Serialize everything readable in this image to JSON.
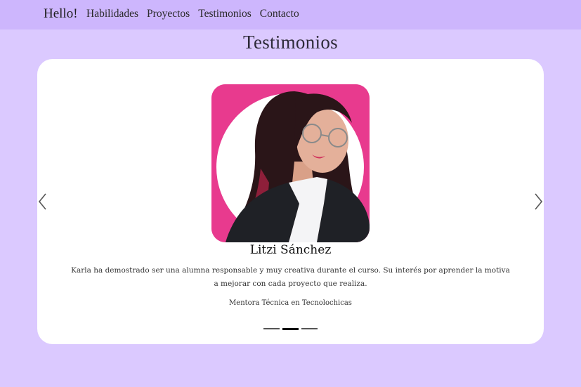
{
  "navbar": {
    "brand": "Hello!",
    "links": [
      "Habilidades",
      "Proyectos",
      "Testimonios",
      "Contacto"
    ]
  },
  "section": {
    "title": "Testimonios"
  },
  "carousel": {
    "name": "Litzi Sánchez",
    "quote": "Karla ha demostrado ser una alumna responsable y muy creativa durante el curso. Su interés por aprender la motiva a mejorar con cada proyecto que realiza.",
    "role": "Mentora Técnica en Tecnolochicas",
    "active_index": 1,
    "slide_count": 3
  },
  "colors": {
    "page_bg": "#dbc9ff",
    "navbar_bg": "#cdb6fd",
    "photo_bg": "#e83a8e"
  }
}
